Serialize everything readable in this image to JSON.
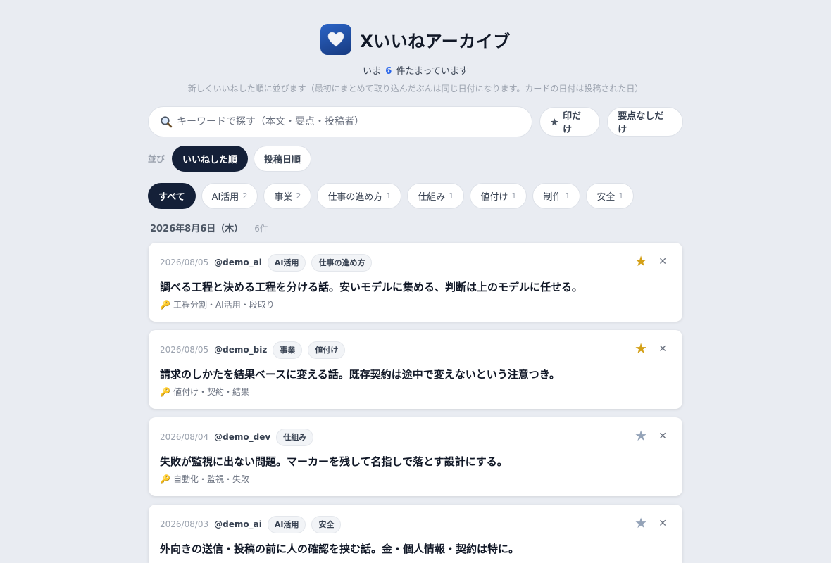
{
  "app": {
    "title": "Xいいねアーカイブ",
    "icon": "heart-icon",
    "count_prefix": "いま",
    "count": "6",
    "count_suffix": "件たまっています",
    "hint": "新しくいいねした順に並びます（最初にまとめて取り込んだぶんは同じ日付になります。カードの日付は投稿された日）"
  },
  "search": {
    "placeholder": "キーワードで探す（本文・要点・投稿者）",
    "value": "",
    "icon": "search-icon"
  },
  "filters": {
    "starred_icon": "star-icon",
    "starred_label": "印だけ",
    "no_summary_label": "要点なしだけ"
  },
  "sort": {
    "label": "並び",
    "options": [
      "いいねした順",
      "投稿日順"
    ],
    "selected": "いいねした順"
  },
  "tags": [
    {
      "label": "すべて",
      "count": "",
      "active": true
    },
    {
      "label": "AI活用",
      "count": "2"
    },
    {
      "label": "事業",
      "count": "2"
    },
    {
      "label": "仕事の進め方",
      "count": "1"
    },
    {
      "label": "仕組み",
      "count": "1"
    },
    {
      "label": "値付け",
      "count": "1"
    },
    {
      "label": "制作",
      "count": "1"
    },
    {
      "label": "安全",
      "count": "1"
    }
  ],
  "group": {
    "date": "2026年8月6日（木）",
    "count": "6件"
  },
  "cards": [
    {
      "date": "2026/08/05",
      "author": "@demo_ai",
      "tags": [
        "AI活用",
        "仕事の進め方"
      ],
      "starred": true,
      "text": "調べる工程と決める工程を分ける話。安いモデルに集める、判断は上のモデルに任せる。",
      "keywords": "工程分割・AI活用・段取り"
    },
    {
      "date": "2026/08/05",
      "author": "@demo_biz",
      "tags": [
        "事業",
        "値付け"
      ],
      "starred": true,
      "text": "請求のしかたを結果ベースに変える話。既存契約は途中で変えないという注意つき。",
      "keywords": "値付け・契約・結果"
    },
    {
      "date": "2026/08/04",
      "author": "@demo_dev",
      "tags": [
        "仕組み"
      ],
      "starred": false,
      "text": "失敗が監視に出ない問題。マーカーを残して名指しで落とす設計にする。",
      "keywords": "自動化・監視・失敗"
    },
    {
      "date": "2026/08/03",
      "author": "@demo_ai",
      "tags": [
        "AI活用",
        "安全"
      ],
      "starred": false,
      "text": "外向きの送信・投稿の前に人の確認を挟む話。金・個人情報・契約は特に。",
      "keywords": ""
    }
  ],
  "icons": {
    "star": "star-icon",
    "close": "close-icon",
    "key": "key-icon"
  },
  "colors": {
    "accent": "#2563eb",
    "dark_chip": "#142038",
    "star_on": "#d4a017",
    "star_off": "#94a3b8",
    "background": "#e9ecf2"
  }
}
